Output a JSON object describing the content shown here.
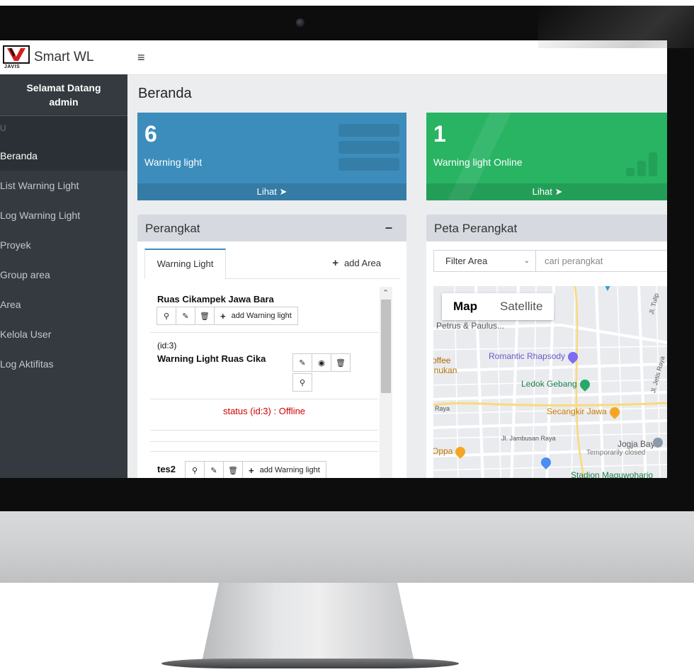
{
  "app": {
    "brand_name": "Smart WL",
    "logo_sub": "JAVIS",
    "menu_icon": "hamburger-icon"
  },
  "sidebar": {
    "welcome_line1": "Selamat Datang",
    "welcome_line2": "admin",
    "header": "U",
    "items": [
      {
        "label": "Beranda",
        "active": true
      },
      {
        "label": "List Warning Light"
      },
      {
        "label": "Log Warning Light"
      },
      {
        "label": "Proyek"
      },
      {
        "label": "Group area"
      },
      {
        "label": "Area"
      },
      {
        "label": "Kelola User"
      },
      {
        "label": "Log Aktifitas"
      }
    ]
  },
  "page": {
    "title": "Beranda"
  },
  "stats": [
    {
      "value": "6",
      "label": "Warning light",
      "link": "Lihat",
      "color": "#3c8dbc"
    },
    {
      "value": "1",
      "label": "Warning light Online",
      "link": "Lihat",
      "color": "#28b463"
    }
  ],
  "perangkat": {
    "title": "Perangkat",
    "tab": "Warning Light",
    "add_area": "add Area",
    "areas": [
      {
        "name": "Ruas Cikampek Jawa Bara",
        "add_label": "add Warning light"
      },
      {
        "id_text": "(id:3)",
        "device": "Warning Light Ruas Cika",
        "status": "status (id:3) : Offline"
      },
      {
        "name": "tes2",
        "add_label": "add Warning light"
      }
    ]
  },
  "peta": {
    "title": "Peta Perangkat",
    "filter": "Filter Area",
    "search_placeholder": "cari perangkat",
    "map_tabs": [
      "Map",
      "Satellite"
    ],
    "labels": {
      "petrus": "Petrus & Paulus...",
      "offee": "offee",
      "inukan": "inukan",
      "romantic": "Romantic Rhapsody",
      "ledok": "Ledok Gebang",
      "raya": "Raya",
      "secangkir": "Secangkir Jawa",
      "jogja": "Jogja Bay",
      "closed": "Temporarily closed",
      "oppa": "Oppa",
      "stadion": "Stadion Maguwoharjo",
      "jambusan": "Jl. Jambusan Raya",
      "tulip": "Jl. Tulip",
      "jetis": "Jl. Jetis Raya"
    }
  }
}
